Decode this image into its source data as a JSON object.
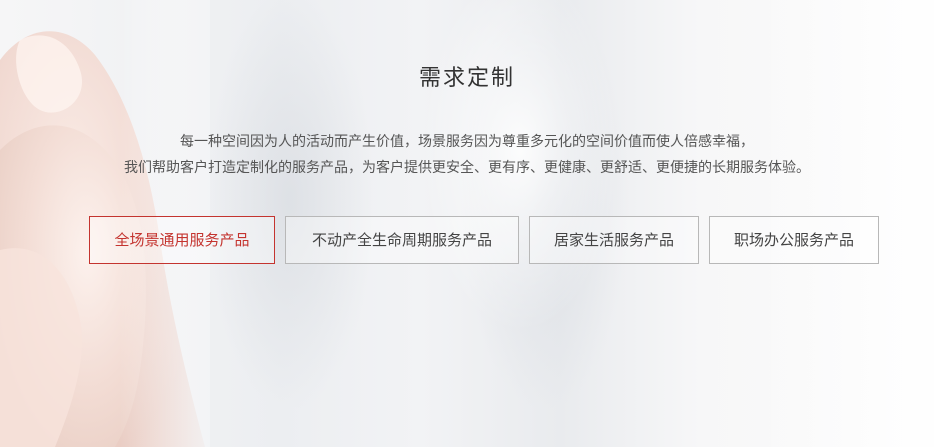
{
  "section": {
    "title": "需求定制",
    "description": [
      "每一种空间因为人的活动而产生价值，场景服务因为尊重多元化的空间价值而使人倍感幸福，",
      "我们帮助客户打造定制化的服务产品，为客户提供更安全、更有序、更健康、更舒适、更便捷的长期服务体验。"
    ],
    "tabs": [
      {
        "label": "全场景通用服务产品",
        "active": true
      },
      {
        "label": "不动产全生命周期服务产品",
        "active": false
      },
      {
        "label": "居家生活服务产品",
        "active": false
      },
      {
        "label": "职场办公服务产品",
        "active": false
      }
    ]
  },
  "colors": {
    "accent": "#c4342f",
    "border": "#b8b8b8",
    "title": "#333333",
    "text": "#555555"
  },
  "icons": {
    "background": "flower-petal-image"
  }
}
